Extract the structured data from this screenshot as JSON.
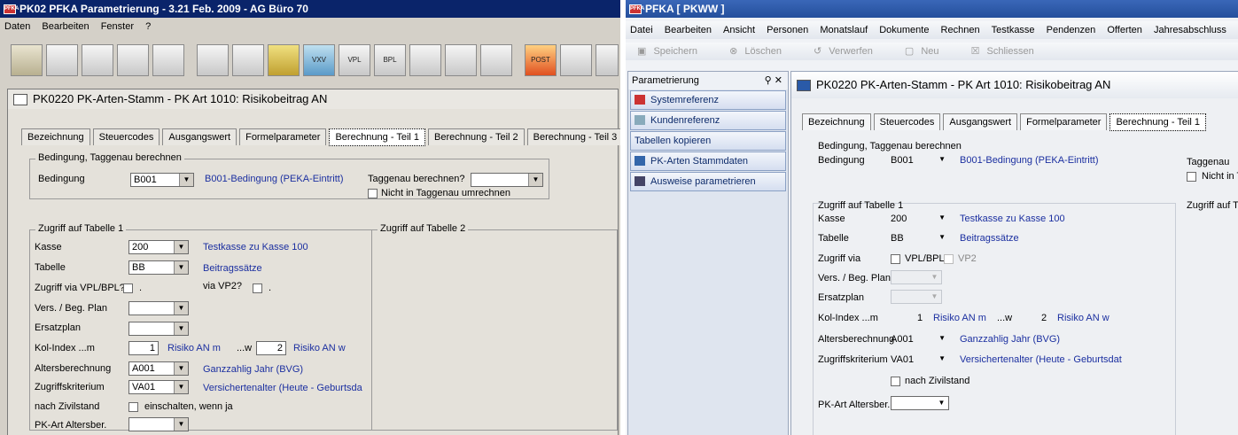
{
  "left": {
    "title": "PK02 PFKA Parametrierung - 3.21 Feb. 2009 - AG Büro 70",
    "app_icon": "PFKA",
    "menu": [
      "Daten",
      "Bearbeiten",
      "Fenster",
      "?"
    ],
    "toolbar_buttons": [
      "chart-icon",
      "people-icon",
      "people2-icon",
      "house-icon",
      "chart2-icon",
      "tree-icon",
      "tree2-icon",
      "form-icon",
      "vxv-icon",
      "vpl-icon",
      "bpl-icon",
      "person-icon",
      "person2-icon",
      "calc-icon",
      "post-icon",
      "chart3-icon",
      "check-icon"
    ],
    "toolbar_texts": {
      "vxv": "VXV",
      "vpl": "VPL",
      "bpl": "BPL",
      "post": "POST"
    },
    "window_title": "PK0220 PK-Arten-Stamm - PK Art 1010: Risikobeitrag AN",
    "tabs": [
      "Bezeichnung",
      "Steuercodes",
      "Ausgangswert",
      "Formelparameter",
      "Berechnung - Teil 1",
      "Berechnung - Teil 2",
      "Berechnung - Teil 3"
    ],
    "group1": {
      "title": "Bedingung, Taggenau berechnen",
      "bedingung_label": "Bedingung",
      "bedingung_value": "B001",
      "bedingung_desc": "B001-Bedingung (PEKA-Eintritt)",
      "taggenau_label": "Taggenau berechnen?",
      "nicht_label": "Nicht in Taggenau umrechnen"
    },
    "group2": {
      "title": "Zugriff auf Tabelle 1",
      "kasse_label": "Kasse",
      "kasse_value": "200",
      "kasse_desc": "Testkasse zu Kasse 100",
      "tabelle_label": "Tabelle",
      "tabelle_value": "BB",
      "tabelle_desc": "Beitragssätze",
      "zugriff_label": "Zugriff via VPL/BPL?",
      "zugriff_dot": ".",
      "vp2_label": "via VP2?",
      "vp2_dot": ".",
      "vers_label": "Vers. / Beg. Plan",
      "ersatz_label": "Ersatzplan",
      "kol_label": "Kol-Index ...m",
      "kol_m": "1",
      "kol_m_desc": "Risiko AN m",
      "kol_w_label": "...w",
      "kol_w": "2",
      "kol_w_desc": "Risiko AN w",
      "alter_label": "Altersberechnung",
      "alter_value": "A001",
      "alter_desc": "Ganzzahlig Jahr (BVG)",
      "krit_label": "Zugriffskriterium",
      "krit_value": "VA01",
      "krit_desc": "Versichertenalter (Heute - Geburtsda",
      "zivil_label": "nach Zivilstand",
      "zivil_desc": "einschalten, wenn ja",
      "pkart_label": "PK-Art Altersber."
    },
    "group3": {
      "title": "Zugriff auf Tabelle 2"
    }
  },
  "right": {
    "title": "PFKA [ PKWW ]",
    "app_icon": "PFKA",
    "menu": [
      "Datei",
      "Bearbeiten",
      "Ansicht",
      "Personen",
      "Monatslauf",
      "Dokumente",
      "Rechnen",
      "Testkasse",
      "Pendenzen",
      "Offerten",
      "Jahresabschluss"
    ],
    "toolbar": [
      "Speichern",
      "Löschen",
      "Verwerfen",
      "Neu",
      "Schliessen"
    ],
    "nav_title": "Parametrierung",
    "nav_pin": "⚲ ✕",
    "nav_items": [
      "Systemreferenz",
      "Kundenreferenz",
      "Tabellen kopieren",
      "PK-Arten Stammdaten",
      "Ausweise parametrieren"
    ],
    "window_title": "PK0220 PK-Arten-Stamm - PK Art 1010: Risikobeitrag AN",
    "tabs": [
      "Bezeichnung",
      "Steuercodes",
      "Ausgangswert",
      "Formelparameter",
      "Berechnung - Teil 1"
    ],
    "group1": {
      "title": "Bedingung, Taggenau berechnen",
      "bedingung_label": "Bedingung",
      "bedingung_value": "B001",
      "bedingung_desc": "B001-Bedingung (PEKA-Eintritt)",
      "taggenau_label": "Taggenau",
      "nicht_label": "Nicht in T"
    },
    "group2": {
      "title": "Zugriff auf Tabelle 1",
      "kasse_label": "Kasse",
      "kasse_value": "200",
      "kasse_desc": "Testkasse zu Kasse 100",
      "tabelle_label": "Tabelle",
      "tabelle_value": "BB",
      "tabelle_desc": "Beitragssätze",
      "zugriff_label": "Zugriff via",
      "vplbpl": "VPL/BPL",
      "vp2": "VP2",
      "vers_label": "Vers. / Beg. Plan",
      "ersatz_label": "Ersatzplan",
      "kol_label": "Kol-Index ...m",
      "kol_m": "1",
      "kol_m_desc": "Risiko AN m",
      "kol_w_label": "...w",
      "kol_w": "2",
      "kol_w_desc": "Risiko AN w",
      "alter_label": "Altersberechnung",
      "alter_value": "A001",
      "alter_desc": "Ganzzahlig Jahr (BVG)",
      "krit_label": "Zugriffskriterium",
      "krit_value": "VA01",
      "krit_desc": "Versichertenalter (Heute - Geburtsdat",
      "zivil_desc": "nach Zivilstand",
      "pkart_label": "PK-Art Altersber."
    },
    "group3": {
      "title": "Zugriff auf Ta"
    }
  }
}
